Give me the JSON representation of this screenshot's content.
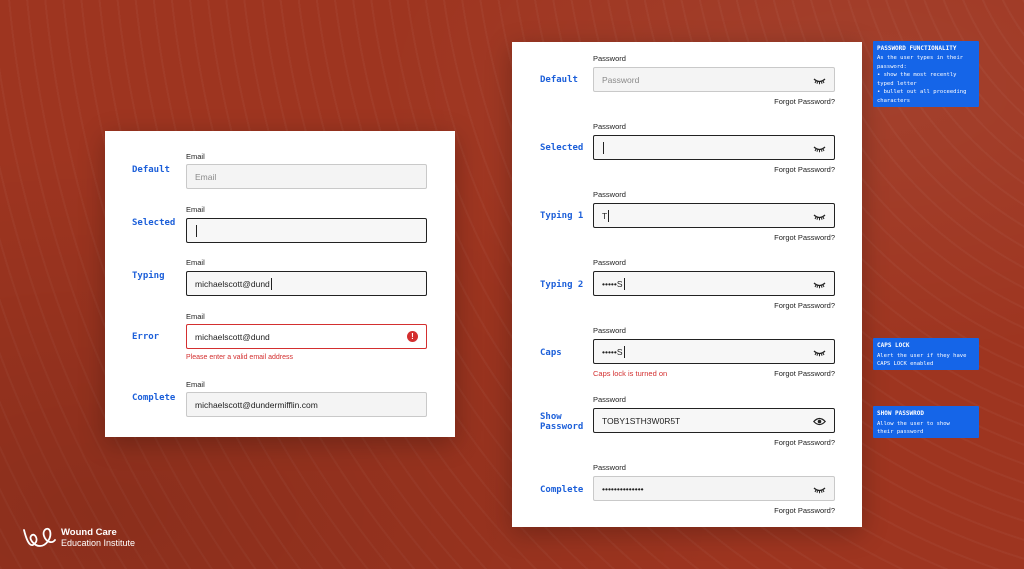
{
  "email_card": {
    "rows": [
      {
        "state": "Default",
        "label": "Email",
        "value": "Email"
      },
      {
        "state": "Selected",
        "label": "Email",
        "value": ""
      },
      {
        "state": "Typing",
        "label": "Email",
        "value": "michaelscott@dund"
      },
      {
        "state": "Error",
        "label": "Email",
        "value": "michaelscott@dund",
        "error": "Please enter a valid email address"
      },
      {
        "state": "Complete",
        "label": "Email",
        "value": "michaelscott@dundermifflin.com"
      }
    ]
  },
  "password_card": {
    "forgot_label": "Forgot Password?",
    "rows": [
      {
        "state": "Default",
        "label": "Password",
        "value": "Password"
      },
      {
        "state": "Selected",
        "label": "Password",
        "value": ""
      },
      {
        "state": "Typing 1",
        "label": "Password",
        "value": "T"
      },
      {
        "state": "Typing 2",
        "label": "Password",
        "value": "•••••S"
      },
      {
        "state": "Caps",
        "label": "Password",
        "value": "•••••S",
        "error": "Caps lock is turned on"
      },
      {
        "state_line1": "Show",
        "state_line2": "Password",
        "label": "Password",
        "value": "TOBY1STH3W0R5T"
      },
      {
        "state": "Complete",
        "label": "Password",
        "value": "••••••••••••••"
      }
    ]
  },
  "notes": {
    "password_functionality": {
      "title": "PASSWORD FUNCTIONALITY",
      "body": "As the user types in their\npassword:\n • show the most recently\n   typed letter\n • bullet out all proceeding\n   characters"
    },
    "caps_lock": {
      "title": "CAPS LOCK",
      "body": "Alert the user if they have\nCAPS LOCK enabled"
    },
    "show_password": {
      "title": "SHOW PASSWROD",
      "body": "Allow the user to show\ntheir password"
    }
  },
  "logo": {
    "line1": "Wound Care",
    "line2": "Education Institute"
  },
  "colors": {
    "background": "#9e3520",
    "accent": "#1c5fd9",
    "note": "#1565e8",
    "error": "#d32f2f"
  },
  "icons": {
    "eye_closed": "eye-closed-icon",
    "eye_open": "eye-open-icon",
    "error": "error-icon"
  }
}
